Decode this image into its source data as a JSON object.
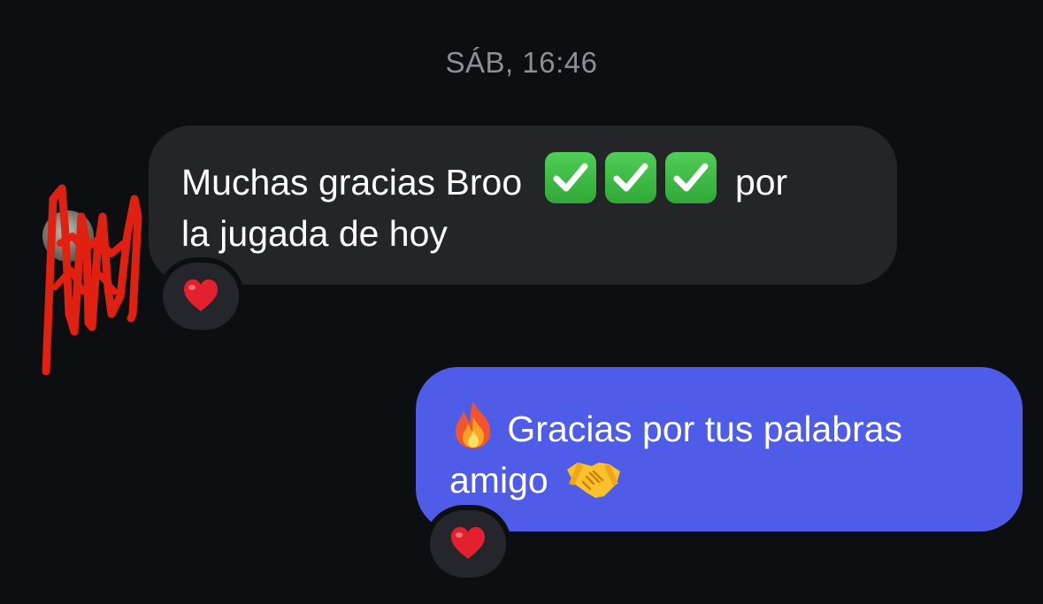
{
  "chat": {
    "timestamp": "SÁB, 16:46",
    "messages": [
      {
        "direction": "incoming",
        "line1_text": "Muchas gracias Broo",
        "line1_emojis": [
          "white-check-mark",
          "white-check-mark",
          "white-check-mark"
        ],
        "line1_after": "por",
        "line2": "la jugada de hoy",
        "reaction": "red-heart"
      },
      {
        "direction": "outgoing",
        "line1_emoji": "fire",
        "line1_text": "Gracias por tus palabras",
        "line2_text": "amigo",
        "line2_emoji": "handshake",
        "reaction": "red-heart"
      }
    ]
  },
  "colors": {
    "background": "#0c0e12",
    "incoming_bubble": "#232529",
    "outgoing_bubble": "#4f5ce7",
    "timestamp": "#8c8f95",
    "redaction_scribble": "#e02010"
  }
}
